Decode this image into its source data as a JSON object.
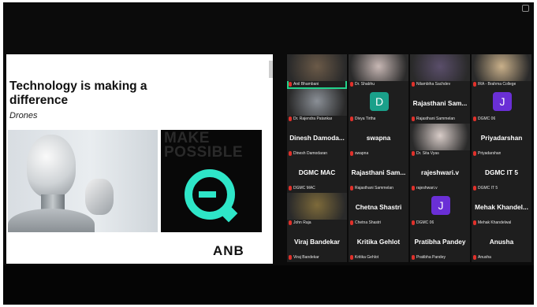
{
  "slide": {
    "title": "Technology is making a difference",
    "subtitle": "Drones",
    "panel_text": "MAKE POSSIBLE",
    "brand": "ANB"
  },
  "colors": {
    "active_speaker_border": "#23d18b",
    "logo_teal": "#2ee6c8",
    "avatar_teal": "#1aa08a",
    "avatar_purple": "#6a2fd6",
    "mic_muted": "#e0312b"
  },
  "participants": [
    {
      "display": "video",
      "caption": "Anil Bhambani",
      "tone": "#6b5a48"
    },
    {
      "display": "video",
      "caption": "Dr. Shabhu",
      "tone": "#c7b7b4"
    },
    {
      "display": "video",
      "caption": "Nilambiha Sachdev",
      "tone": "#5a4e6a"
    },
    {
      "display": "video",
      "caption": "IRA - Brahma College",
      "tone": "#c9b08a"
    },
    {
      "display": "video",
      "caption": "Dr. Rajendra Patankar",
      "tone": "#8a8f96"
    },
    {
      "display": "initial",
      "initial": "D",
      "initial_color": "#1aa08a",
      "caption": "Divya Tirtha"
    },
    {
      "display": "name",
      "name": "Rajasthani Sam...",
      "caption": "Rajasthani Sammelan"
    },
    {
      "display": "initial",
      "initial": "J",
      "initial_color": "#6a2fd6",
      "caption": "DGMC 06"
    },
    {
      "display": "name",
      "name": "Dinesh Damoda...",
      "caption": "Dinesh Damodaran"
    },
    {
      "display": "name",
      "name": "swapna",
      "caption": "swapna"
    },
    {
      "display": "video",
      "caption": "Dr. Sita Vyas",
      "tone": "#d8ccc8"
    },
    {
      "display": "name",
      "name": "Priyadarshan",
      "caption": "Priyadarshan"
    },
    {
      "display": "name",
      "name": "DGMC MAC",
      "caption": "DGMC MAC"
    },
    {
      "display": "name",
      "name": "Rajasthani Sam...",
      "caption": "Rajasthani Sammelan"
    },
    {
      "display": "name",
      "name": "rajeshwari.v",
      "caption": "rajeshwari.v"
    },
    {
      "display": "name",
      "name": "DGMC IT 5",
      "caption": "DGMC IT 5"
    },
    {
      "display": "video",
      "caption": "John Raja",
      "tone": "#7d6a3a"
    },
    {
      "display": "name",
      "name": "Chetna Shastri",
      "caption": "Chetna Shastri"
    },
    {
      "display": "initial",
      "initial": "J",
      "initial_color": "#6a2fd6",
      "caption": "DGMC 06"
    },
    {
      "display": "name",
      "name": "Mehak Khandel...",
      "caption": "Mehak Khandelwal"
    },
    {
      "display": "name",
      "name": "Viraj Bandekar",
      "caption": "Viraj Bandekar"
    },
    {
      "display": "name",
      "name": "Kritika Gehlot",
      "caption": "Kritika Gehlot"
    },
    {
      "display": "name",
      "name": "Pratibha Pandey",
      "caption": "Pratibha Pandey"
    },
    {
      "display": "name",
      "name": "Anusha",
      "caption": "Anusha"
    }
  ]
}
